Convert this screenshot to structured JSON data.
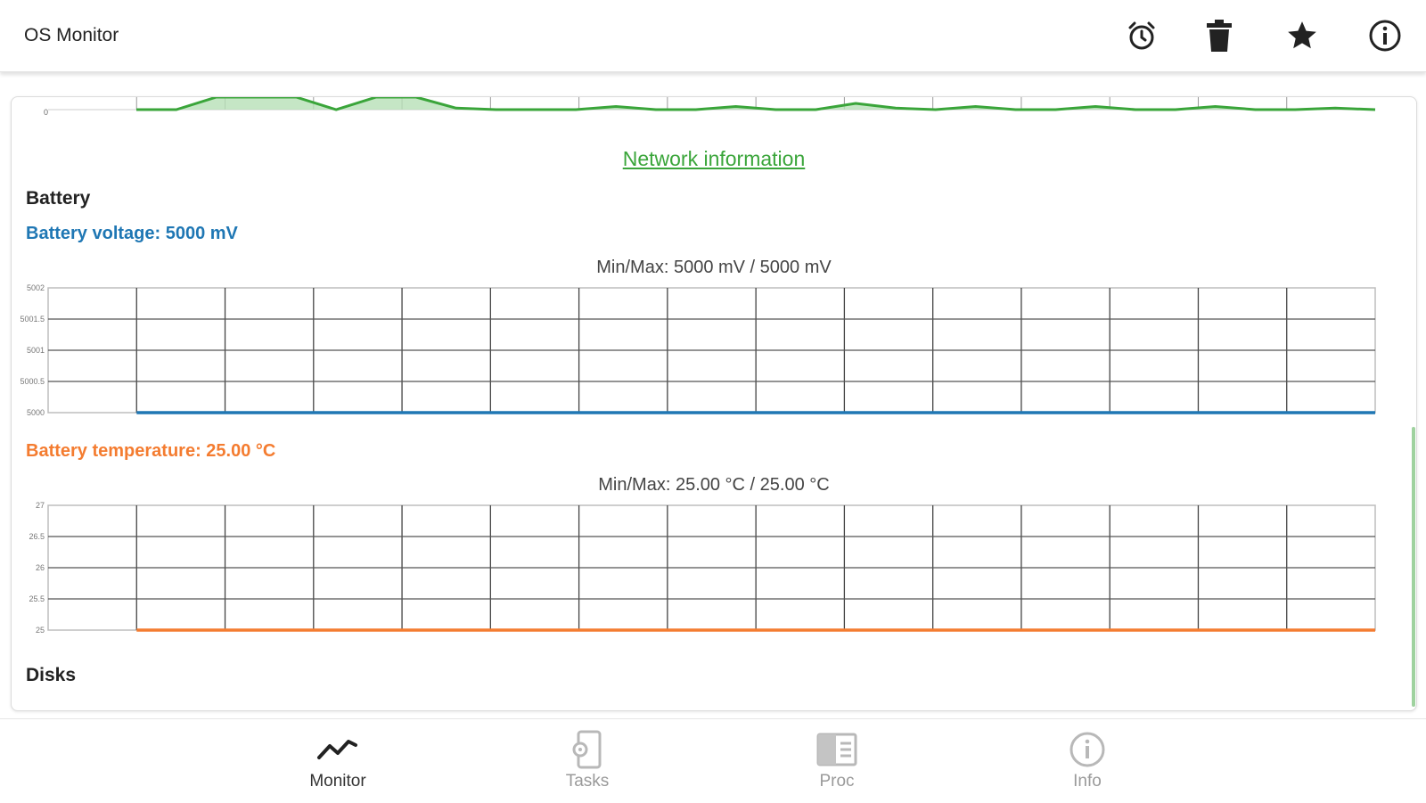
{
  "app": {
    "title": "OS Monitor"
  },
  "toolbar": {
    "icons": [
      "alarm-icon",
      "delete-icon",
      "star-icon",
      "info-icon"
    ]
  },
  "network": {
    "link_label": "Network information",
    "chart_data": {
      "type": "area",
      "y_tick_labels": [
        "0"
      ],
      "color": "#3aa53a",
      "values": [
        0,
        0,
        8,
        8,
        8,
        0,
        8,
        8,
        1,
        0,
        0,
        0,
        2,
        0,
        0,
        2,
        0,
        0,
        4,
        1,
        0,
        2,
        0,
        0,
        2,
        0,
        0,
        2,
        0,
        0,
        1,
        0
      ]
    }
  },
  "battery": {
    "section_title": "Battery",
    "voltage": {
      "label": "Battery voltage: 5000 mV",
      "minmax": "Min/Max: 5000 mV / 5000 mV",
      "color": "#1f77b4",
      "chart_data": {
        "type": "line",
        "y_tick_labels": [
          "5002",
          "5001.5",
          "5001",
          "5000.5",
          "5000"
        ],
        "ylim": [
          5000,
          5002
        ],
        "values": [
          5000,
          5000,
          5000,
          5000,
          5000,
          5000,
          5000,
          5000,
          5000,
          5000,
          5000,
          5000,
          5000,
          5000,
          5000,
          5000
        ]
      }
    },
    "temperature": {
      "label": "Battery temperature: 25.00 °C",
      "minmax": "Min/Max: 25.00 °C / 25.00 °C",
      "color": "#f47c30",
      "chart_data": {
        "type": "line",
        "y_tick_labels": [
          "27",
          "26.5",
          "26",
          "25.5",
          "25"
        ],
        "ylim": [
          25,
          27
        ],
        "values": [
          25,
          25,
          25,
          25,
          25,
          25,
          25,
          25,
          25,
          25,
          25,
          25,
          25,
          25,
          25,
          25
        ]
      }
    }
  },
  "disks": {
    "section_title": "Disks"
  },
  "bottom_nav": {
    "items": [
      {
        "label": "Monitor",
        "icon": "chart-line-icon",
        "active": true
      },
      {
        "label": "Tasks",
        "icon": "tasks-icon",
        "active": false
      },
      {
        "label": "Proc",
        "icon": "proc-icon",
        "active": false
      },
      {
        "label": "Info",
        "icon": "info-icon",
        "active": false
      }
    ]
  }
}
